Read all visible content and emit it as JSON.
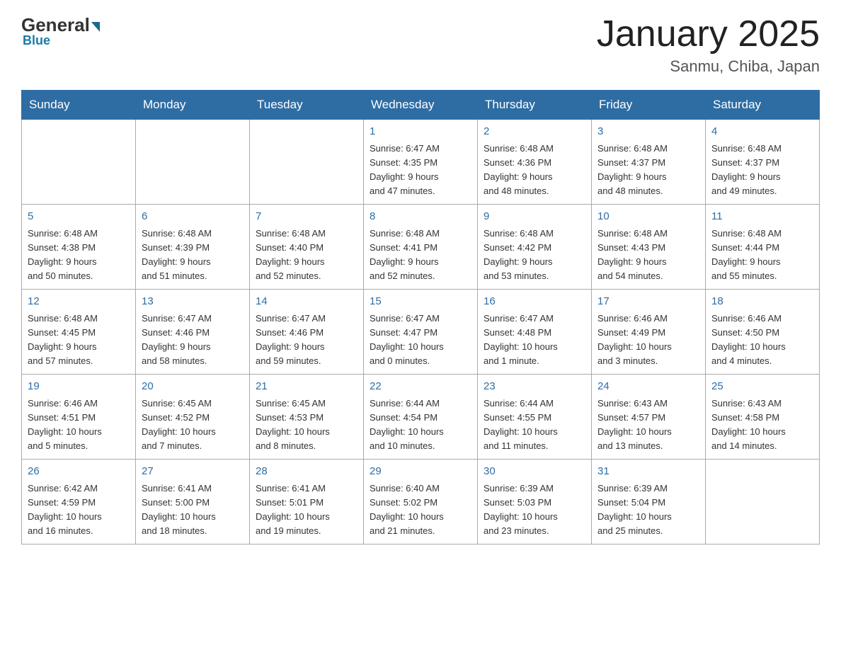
{
  "header": {
    "logo_general": "General",
    "logo_blue": "Blue",
    "month_title": "January 2025",
    "location": "Sanmu, Chiba, Japan"
  },
  "days_of_week": [
    "Sunday",
    "Monday",
    "Tuesday",
    "Wednesday",
    "Thursday",
    "Friday",
    "Saturday"
  ],
  "weeks": [
    [
      {
        "day": "",
        "info": ""
      },
      {
        "day": "",
        "info": ""
      },
      {
        "day": "",
        "info": ""
      },
      {
        "day": "1",
        "info": "Sunrise: 6:47 AM\nSunset: 4:35 PM\nDaylight: 9 hours\nand 47 minutes."
      },
      {
        "day": "2",
        "info": "Sunrise: 6:48 AM\nSunset: 4:36 PM\nDaylight: 9 hours\nand 48 minutes."
      },
      {
        "day": "3",
        "info": "Sunrise: 6:48 AM\nSunset: 4:37 PM\nDaylight: 9 hours\nand 48 minutes."
      },
      {
        "day": "4",
        "info": "Sunrise: 6:48 AM\nSunset: 4:37 PM\nDaylight: 9 hours\nand 49 minutes."
      }
    ],
    [
      {
        "day": "5",
        "info": "Sunrise: 6:48 AM\nSunset: 4:38 PM\nDaylight: 9 hours\nand 50 minutes."
      },
      {
        "day": "6",
        "info": "Sunrise: 6:48 AM\nSunset: 4:39 PM\nDaylight: 9 hours\nand 51 minutes."
      },
      {
        "day": "7",
        "info": "Sunrise: 6:48 AM\nSunset: 4:40 PM\nDaylight: 9 hours\nand 52 minutes."
      },
      {
        "day": "8",
        "info": "Sunrise: 6:48 AM\nSunset: 4:41 PM\nDaylight: 9 hours\nand 52 minutes."
      },
      {
        "day": "9",
        "info": "Sunrise: 6:48 AM\nSunset: 4:42 PM\nDaylight: 9 hours\nand 53 minutes."
      },
      {
        "day": "10",
        "info": "Sunrise: 6:48 AM\nSunset: 4:43 PM\nDaylight: 9 hours\nand 54 minutes."
      },
      {
        "day": "11",
        "info": "Sunrise: 6:48 AM\nSunset: 4:44 PM\nDaylight: 9 hours\nand 55 minutes."
      }
    ],
    [
      {
        "day": "12",
        "info": "Sunrise: 6:48 AM\nSunset: 4:45 PM\nDaylight: 9 hours\nand 57 minutes."
      },
      {
        "day": "13",
        "info": "Sunrise: 6:47 AM\nSunset: 4:46 PM\nDaylight: 9 hours\nand 58 minutes."
      },
      {
        "day": "14",
        "info": "Sunrise: 6:47 AM\nSunset: 4:46 PM\nDaylight: 9 hours\nand 59 minutes."
      },
      {
        "day": "15",
        "info": "Sunrise: 6:47 AM\nSunset: 4:47 PM\nDaylight: 10 hours\nand 0 minutes."
      },
      {
        "day": "16",
        "info": "Sunrise: 6:47 AM\nSunset: 4:48 PM\nDaylight: 10 hours\nand 1 minute."
      },
      {
        "day": "17",
        "info": "Sunrise: 6:46 AM\nSunset: 4:49 PM\nDaylight: 10 hours\nand 3 minutes."
      },
      {
        "day": "18",
        "info": "Sunrise: 6:46 AM\nSunset: 4:50 PM\nDaylight: 10 hours\nand 4 minutes."
      }
    ],
    [
      {
        "day": "19",
        "info": "Sunrise: 6:46 AM\nSunset: 4:51 PM\nDaylight: 10 hours\nand 5 minutes."
      },
      {
        "day": "20",
        "info": "Sunrise: 6:45 AM\nSunset: 4:52 PM\nDaylight: 10 hours\nand 7 minutes."
      },
      {
        "day": "21",
        "info": "Sunrise: 6:45 AM\nSunset: 4:53 PM\nDaylight: 10 hours\nand 8 minutes."
      },
      {
        "day": "22",
        "info": "Sunrise: 6:44 AM\nSunset: 4:54 PM\nDaylight: 10 hours\nand 10 minutes."
      },
      {
        "day": "23",
        "info": "Sunrise: 6:44 AM\nSunset: 4:55 PM\nDaylight: 10 hours\nand 11 minutes."
      },
      {
        "day": "24",
        "info": "Sunrise: 6:43 AM\nSunset: 4:57 PM\nDaylight: 10 hours\nand 13 minutes."
      },
      {
        "day": "25",
        "info": "Sunrise: 6:43 AM\nSunset: 4:58 PM\nDaylight: 10 hours\nand 14 minutes."
      }
    ],
    [
      {
        "day": "26",
        "info": "Sunrise: 6:42 AM\nSunset: 4:59 PM\nDaylight: 10 hours\nand 16 minutes."
      },
      {
        "day": "27",
        "info": "Sunrise: 6:41 AM\nSunset: 5:00 PM\nDaylight: 10 hours\nand 18 minutes."
      },
      {
        "day": "28",
        "info": "Sunrise: 6:41 AM\nSunset: 5:01 PM\nDaylight: 10 hours\nand 19 minutes."
      },
      {
        "day": "29",
        "info": "Sunrise: 6:40 AM\nSunset: 5:02 PM\nDaylight: 10 hours\nand 21 minutes."
      },
      {
        "day": "30",
        "info": "Sunrise: 6:39 AM\nSunset: 5:03 PM\nDaylight: 10 hours\nand 23 minutes."
      },
      {
        "day": "31",
        "info": "Sunrise: 6:39 AM\nSunset: 5:04 PM\nDaylight: 10 hours\nand 25 minutes."
      },
      {
        "day": "",
        "info": ""
      }
    ]
  ]
}
